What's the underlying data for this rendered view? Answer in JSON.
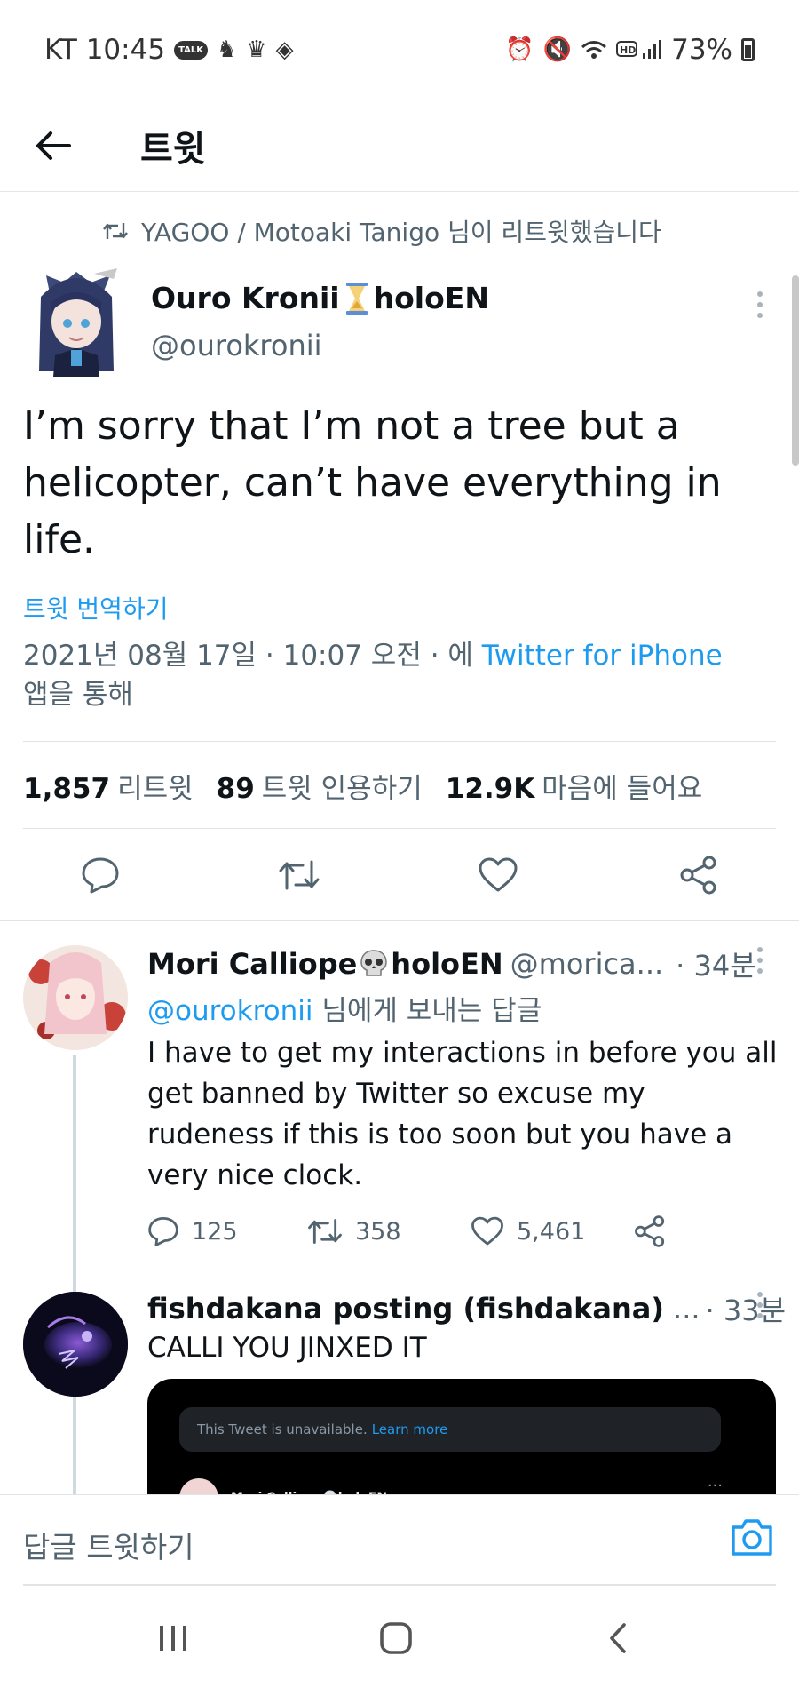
{
  "status_bar": {
    "carrier_time": "KT 10:45",
    "talk_badge": "TALK",
    "battery": "73%"
  },
  "topbar": {
    "title": "트윗"
  },
  "retweet_context": "YAGOO / Motoaki Tanigo 님이 리트윗했습니다",
  "tweet": {
    "author_name": "Ouro Kronii",
    "author_name_suffix": "holoEN",
    "author_handle": "@ourokronii",
    "text": "I’m sorry that I’m not a tree but a helicopter, can’t have everything in life.",
    "translate": "트윗 번역하기",
    "meta_date": "2021년 08월 17일 · 10:07 오전 · 에 ",
    "meta_source": "Twitter for iPhone",
    "meta_via": "앱을 통해",
    "stats": {
      "retweets": "1,857",
      "retweets_label": "리트윗",
      "quotes": "89",
      "quotes_label": "트윗 인용하기",
      "likes": "12.9K",
      "likes_label": "마음에 들어요"
    }
  },
  "replies": [
    {
      "name": "Mori Calliope",
      "name_suffix": "holoEN",
      "handle": "@morica...",
      "time": "· 34분",
      "reply_to_mention": "@ourokronii",
      "reply_to_suffix": " 님에게 보내는 답글",
      "text": "I have to get my interactions in before you all get banned by Twitter so excuse my rudeness if this is too soon but you have a very nice clock.",
      "reply_count": "125",
      "retweet_count": "358",
      "like_count": "5,461"
    },
    {
      "name": "fishdakana posting (fishdakana)",
      "handle": "...",
      "time": "· 33분",
      "text": "CALLI YOU JINXED IT",
      "embed": {
        "unavailable": "This Tweet is unavailable.",
        "learn_more": "Learn more",
        "user": "Mori Calliope💀holoEN",
        "dots": "···"
      }
    }
  ],
  "compose": {
    "placeholder": "답글 트윗하기"
  },
  "colors": {
    "accent": "#1d9bf0",
    "text": "#0f1419",
    "muted": "#536471"
  },
  "icons": [
    "back-arrow-icon",
    "retweet-icon",
    "more-icon",
    "reply-icon",
    "like-icon",
    "share-icon",
    "camera-icon",
    "recent-apps-icon",
    "home-icon",
    "nav-back-icon"
  ]
}
